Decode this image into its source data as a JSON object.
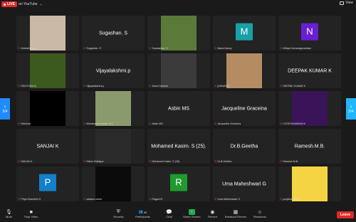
{
  "topbar": {
    "live_label": "LIVE",
    "platform": "on YouTube",
    "view_label": "View"
  },
  "pager": {
    "left": "2/4",
    "right": "2/4"
  },
  "tiles": [
    {
      "name": "Amirath Amir",
      "type": "photo",
      "photo_color": "#c9b9a6"
    },
    {
      "name": "Sugashan. S",
      "type": "text",
      "display": "Sugashan. S"
    },
    {
      "name": "Sarwashan. S",
      "type": "photo",
      "photo_color": "#5b7a3a"
    },
    {
      "name": "Maria Nancy",
      "type": "avatar",
      "letter": "M",
      "color": "#18a0a8"
    },
    {
      "name": "Nithya Veeraragavandan",
      "type": "avatar",
      "letter": "N",
      "color": "#6a1fd0"
    },
    {
      "name": "PAVITHRA M",
      "type": "photo",
      "photo_color": "#3d5a1e"
    },
    {
      "name": "Vijayalakshmi.p",
      "type": "text",
      "display": "Vijayalakshmi.p"
    },
    {
      "name": "Abdul Sameer",
      "type": "photo",
      "photo_color": "#3b3b3b"
    },
    {
      "name": "[ASWATH]",
      "type": "photo",
      "photo_color": "#b58b62"
    },
    {
      "name": "DEEPAK KUMAR K",
      "type": "text",
      "display": "DEEPAK KUMAR K"
    },
    {
      "name": "Reshma",
      "type": "photo",
      "photo_color": "#000000"
    },
    {
      "name": "Mohammed Ismail .B.S",
      "type": "photo",
      "photo_color": "#8a9a6c"
    },
    {
      "name": "Asbin MS",
      "type": "text",
      "display": "Asbin MS"
    },
    {
      "name": "Jacqueline Graceina",
      "type": "text",
      "display": "Jacqueline Graceina"
    },
    {
      "name": "LOGESHWARAN.K",
      "type": "photo",
      "photo_color": "#3a1458"
    },
    {
      "name": "SANJAI K",
      "type": "text",
      "display": "SANJAI K"
    },
    {
      "name": "Nisha Siddique",
      "type": "photo",
      "photo_color": "#2a2a2a"
    },
    {
      "name": "Mohamed Kasim. S (25).",
      "type": "text",
      "display": "Mohamed Kasim. S (25)."
    },
    {
      "name": "Dr.B.Geetha",
      "type": "text",
      "display": "Dr.B.Geetha"
    },
    {
      "name": "Ramesh.M.B.",
      "type": "text",
      "display": "Ramesh.M.B."
    },
    {
      "name": "Priya Dharshini.S",
      "type": "avatar",
      "letter": "P",
      "color": "#1380c8"
    },
    {
      "name": "sadana shree",
      "type": "photo",
      "photo_color": "#0b0b0b"
    },
    {
      "name": "Ragavi.R",
      "type": "avatar",
      "letter": "R",
      "color": "#1f9a2e"
    },
    {
      "name": "Uma Maheshwari G",
      "type": "text",
      "display": "Uma Maheshwari G"
    },
    {
      "name": "poojitha Pooja",
      "type": "photo",
      "photo_color": "#f4d443"
    }
  ],
  "toolbar": {
    "mute": "Mute",
    "stop_video": "Stop Video",
    "security": "Security",
    "participants": "Participants",
    "participants_count": "69",
    "chat": "Chat",
    "share_screen": "Share Screen",
    "record": "Record",
    "breakout_rooms": "Breakout Rooms",
    "reactions": "Reactions",
    "leave": "Leave"
  },
  "colors": {
    "accent": "#1f8bff",
    "leave": "#e02828",
    "live": "#e02828",
    "share": "#1fad4e"
  }
}
